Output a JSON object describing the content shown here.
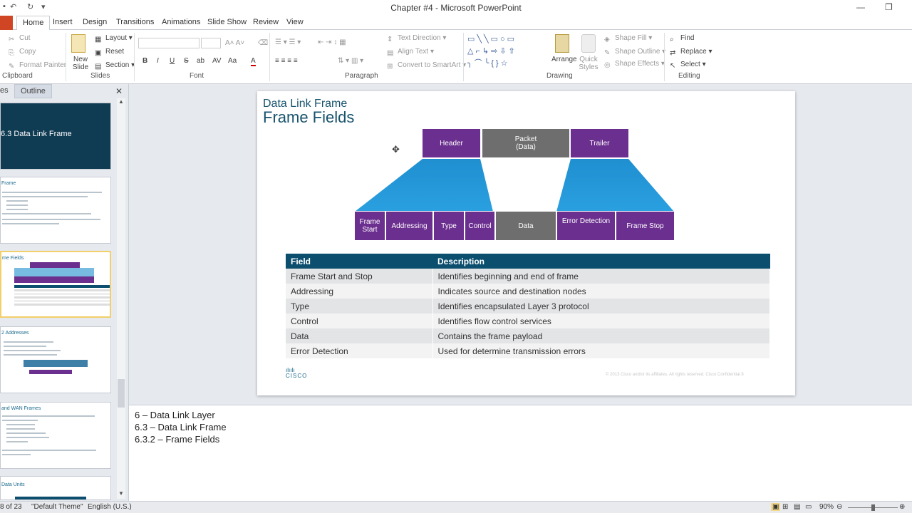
{
  "window": {
    "title": "Chapter #4 - Microsoft PowerPoint"
  },
  "tabs": [
    "Home",
    "Insert",
    "Design",
    "Transitions",
    "Animations",
    "Slide Show",
    "Review",
    "View"
  ],
  "ribbon": {
    "clipboard": {
      "cut": "Cut",
      "copy": "Copy",
      "format_painter": "Format Painter",
      "label": "Clipboard"
    },
    "slides": {
      "new_slide": "New Slide",
      "layout": "Layout",
      "reset": "Reset",
      "section": "Section",
      "label": "Slides"
    },
    "font": {
      "label": "Font",
      "bold": "B",
      "italic": "I",
      "underline": "U",
      "strike": "S",
      "shadow": "ab",
      "spacing": "AV",
      "case": "Aa",
      "color": "A"
    },
    "paragraph": {
      "text_direction": "Text Direction",
      "align_text": "Align Text",
      "convert_smartart": "Convert to SmartArt",
      "label": "Paragraph"
    },
    "drawing": {
      "arrange": "Arrange",
      "quick_styles": "Quick Styles",
      "shape_fill": "Shape Fill",
      "shape_outline": "Shape Outline",
      "shape_effects": "Shape Effects",
      "label": "Drawing"
    },
    "editing": {
      "find": "Find",
      "replace": "Replace",
      "select": "Select",
      "label": "Editing"
    }
  },
  "pane": {
    "tab_slides": "es",
    "tab_outline": "Outline",
    "close": "✕"
  },
  "thumbs": [
    {
      "title": "6.3 Data Link Frame"
    },
    {
      "title": "Frame"
    },
    {
      "title": "me Fields"
    },
    {
      "title": "2 Addresses"
    },
    {
      "title": "and WAN Frames"
    },
    {
      "title": "Data Units"
    }
  ],
  "slide": {
    "subtitle": "Data Link Frame",
    "title": "Frame Fields",
    "top_header": "Header",
    "top_packet": "Packet\n(Data)",
    "top_trailer": "Trailer",
    "fields": [
      "Frame\nStart",
      "Addressing",
      "Type",
      "Control",
      "Data",
      "Error Detection",
      "Frame Stop"
    ],
    "table_headers": [
      "Field",
      "Description"
    ],
    "rows": [
      [
        "Frame Start and Stop",
        "Identifies beginning and end of frame"
      ],
      [
        "Addressing",
        "Indicates source and destination nodes"
      ],
      [
        "Type",
        "Identifies encapsulated Layer 3 protocol"
      ],
      [
        "Control",
        "Identifies flow control services"
      ],
      [
        "Data",
        "Contains the frame payload"
      ],
      [
        "Error Detection",
        "Used for determine transmission errors"
      ]
    ],
    "logo": "CISCO",
    "copyright": "© 2013 Cisco and/or its affiliates. All rights reserved.   Cisco Confidential   8"
  },
  "notes": [
    "6 – Data Link Layer",
    "6.3 – Data Link Frame",
    "6.3.2 – Frame Fields"
  ],
  "status": {
    "slide": "8 of 23",
    "theme": "\"Default Theme\"",
    "lang": "English (U.S.)",
    "zoom": "90%"
  }
}
